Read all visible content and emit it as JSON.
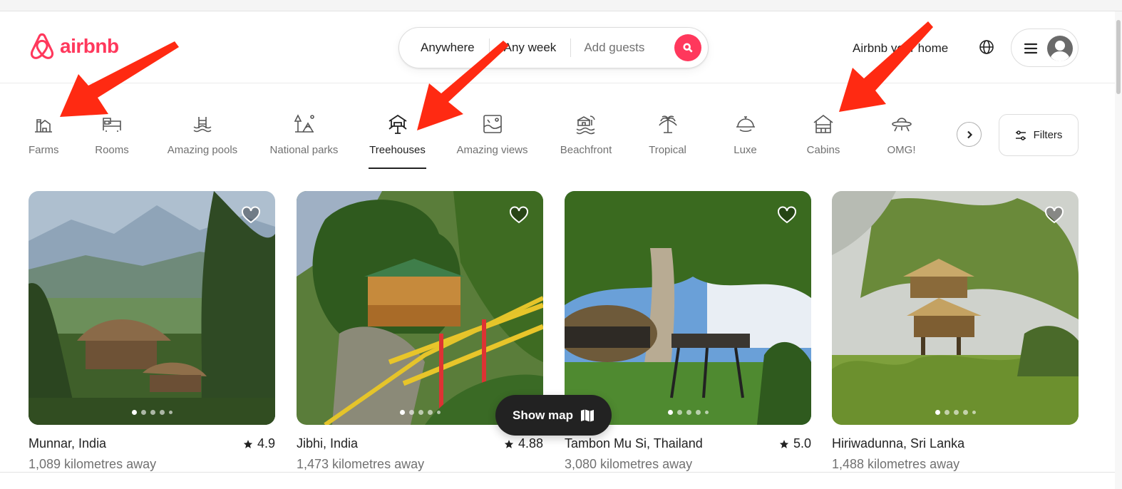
{
  "brand": {
    "logo_text": "airbnb",
    "accent_color": "#ff385c"
  },
  "search": {
    "where": "Anywhere",
    "when": "Any week",
    "guests_placeholder": "Add guests",
    "button_icon": "search-icon"
  },
  "header": {
    "host_link": "Airbnb your home",
    "language_icon": "globe-icon",
    "menu_icon": "hamburger-menu-icon",
    "avatar_icon": "user-avatar-icon"
  },
  "categories": [
    {
      "label": "Farms",
      "icon": "farm-icon",
      "active": false
    },
    {
      "label": "Rooms",
      "icon": "bed-icon",
      "active": false
    },
    {
      "label": "Amazing pools",
      "icon": "pool-icon",
      "active": false
    },
    {
      "label": "National parks",
      "icon": "national-park-icon",
      "active": false
    },
    {
      "label": "Treehouses",
      "icon": "treehouse-icon",
      "active": true
    },
    {
      "label": "Amazing views",
      "icon": "view-icon",
      "active": false
    },
    {
      "label": "Beachfront",
      "icon": "beach-icon",
      "active": false
    },
    {
      "label": "Tropical",
      "icon": "palm-icon",
      "active": false
    },
    {
      "label": "Luxe",
      "icon": "cloche-icon",
      "active": false
    },
    {
      "label": "Cabins",
      "icon": "cabin-icon",
      "active": false
    },
    {
      "label": "OMG!",
      "icon": "ufo-icon",
      "active": false
    }
  ],
  "filters": {
    "label": "Filters",
    "icon": "sliders-icon"
  },
  "listings": [
    {
      "location": "Munnar, India",
      "rating": "4.9",
      "distance": "1,089 kilometres away"
    },
    {
      "location": "Jibhi, India",
      "rating": "4.88",
      "distance": "1,473 kilometres away"
    },
    {
      "location": "Tambon Mu Si, Thailand",
      "rating": "5.0",
      "distance": "3,080 kilometres away"
    },
    {
      "location": "Hiriwadunna, Sri Lanka",
      "rating": "",
      "distance": "1,488 kilometres away"
    }
  ],
  "show_map": {
    "label": "Show map",
    "icon": "map-icon"
  },
  "annotation_arrows": {
    "color": "#ff2a12",
    "targets": [
      "Farms",
      "Treehouses",
      "Cabins"
    ]
  }
}
